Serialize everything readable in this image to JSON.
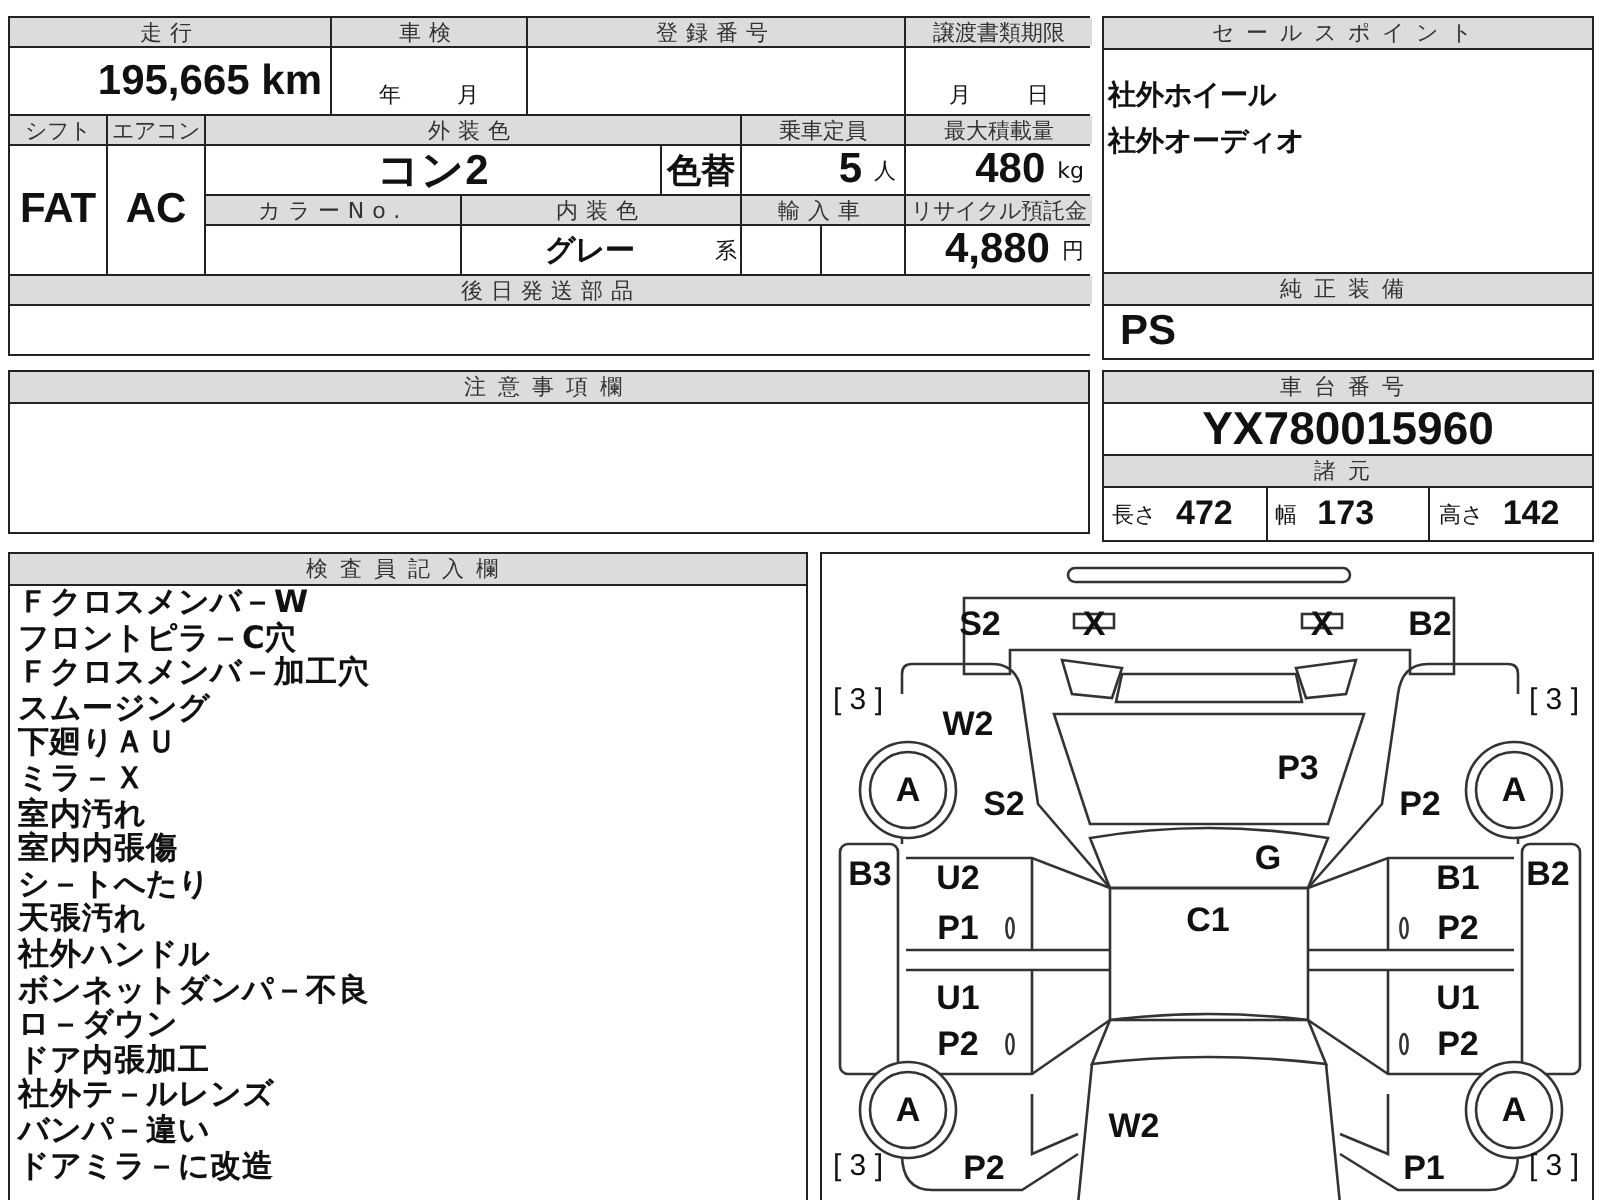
{
  "top_table": {
    "mileage": {
      "label": "走行",
      "value": "195,665 km"
    },
    "shaken": {
      "label": "車検",
      "year_unit": "年",
      "month_unit": "月"
    },
    "registration_number": {
      "label": "登録番号"
    },
    "transfer_deadline": {
      "label": "譲渡書類期限",
      "month_unit": "月",
      "day_unit": "日"
    },
    "shift": {
      "label": "シフト",
      "value": "FAT"
    },
    "aircon": {
      "label": "エアコン",
      "value": "AC"
    },
    "exterior_color": {
      "label": "外装色",
      "value": "コン2",
      "repaint_mark": "色替"
    },
    "capacity": {
      "label": "乗車定員",
      "value": "5",
      "unit": "人"
    },
    "max_load": {
      "label": "最大積載量",
      "value": "480",
      "unit": "kg"
    },
    "color_number": {
      "label": "カラーNo."
    },
    "interior_color": {
      "label": "内装色",
      "value": "グレー",
      "suffix": "系"
    },
    "imported": {
      "label": "輸入車"
    },
    "recycle_fee": {
      "label": "リサイクル預託金",
      "value": "4,880",
      "unit": "円"
    },
    "later_parts": {
      "label": "後日発送部品"
    }
  },
  "sales_points": {
    "label": "セールスポイント",
    "items": [
      "社外ホイール",
      "社外オーディオ"
    ]
  },
  "standard_equipment": {
    "label": "純正装備",
    "value": "PS"
  },
  "notes": {
    "label": "注意事項欄"
  },
  "chassis": {
    "label": "車台番号",
    "value": "YX780015960"
  },
  "specs": {
    "label": "諸元",
    "items": [
      {
        "label": "長さ",
        "value": "472"
      },
      {
        "label": "幅",
        "value": "173"
      },
      {
        "label": "高さ",
        "value": "142"
      }
    ]
  },
  "inspector_notes": {
    "label": "検査員記入欄",
    "items": [
      "Ｆクロスメンバ－W",
      "フロントピラ－C穴",
      "Ｆクロスメンバ－加工穴",
      "スムージング",
      "下廻りＡＵ",
      "ミラ－Ｘ",
      "室内汚れ",
      "室内内張傷",
      "シ－トへたり",
      "天張汚れ",
      "社外ハンドル",
      "ボンネットダンパ－不良",
      "ロ－ダウン",
      "ドア内張加工",
      "社外テ－ルレンズ",
      "バンパ－違い",
      "ドアミラ－に改造"
    ]
  },
  "diagram": {
    "marks": [
      {
        "kind": "code",
        "text": "S2"
      },
      {
        "kind": "code",
        "text": "X"
      },
      {
        "kind": "code",
        "text": "X"
      },
      {
        "kind": "code",
        "text": "B2"
      },
      {
        "kind": "tire",
        "text": "[ 3 ]"
      },
      {
        "kind": "tire",
        "text": "[ 3 ]"
      },
      {
        "kind": "code",
        "text": "W2"
      },
      {
        "kind": "wheel",
        "text": "A"
      },
      {
        "kind": "code",
        "text": "S2"
      },
      {
        "kind": "code",
        "text": "P3"
      },
      {
        "kind": "code",
        "text": "P2"
      },
      {
        "kind": "wheel",
        "text": "A"
      },
      {
        "kind": "code",
        "text": "G"
      },
      {
        "kind": "code",
        "text": "B3"
      },
      {
        "kind": "code",
        "text": "U2"
      },
      {
        "kind": "code",
        "text": "P1"
      },
      {
        "kind": "code",
        "text": "C1"
      },
      {
        "kind": "code",
        "text": "B1"
      },
      {
        "kind": "code",
        "text": "B2"
      },
      {
        "kind": "code",
        "text": "P2"
      },
      {
        "kind": "code",
        "text": "U1"
      },
      {
        "kind": "code",
        "text": "P2"
      },
      {
        "kind": "code",
        "text": "U1"
      },
      {
        "kind": "code",
        "text": "P2"
      },
      {
        "kind": "wheel",
        "text": "A"
      },
      {
        "kind": "wheel",
        "text": "A"
      },
      {
        "kind": "code",
        "text": "W2"
      },
      {
        "kind": "tire",
        "text": "[ 3 ]"
      },
      {
        "kind": "code",
        "text": "P2"
      },
      {
        "kind": "code",
        "text": "P1"
      },
      {
        "kind": "tire",
        "text": "[ 3 ]"
      }
    ]
  }
}
